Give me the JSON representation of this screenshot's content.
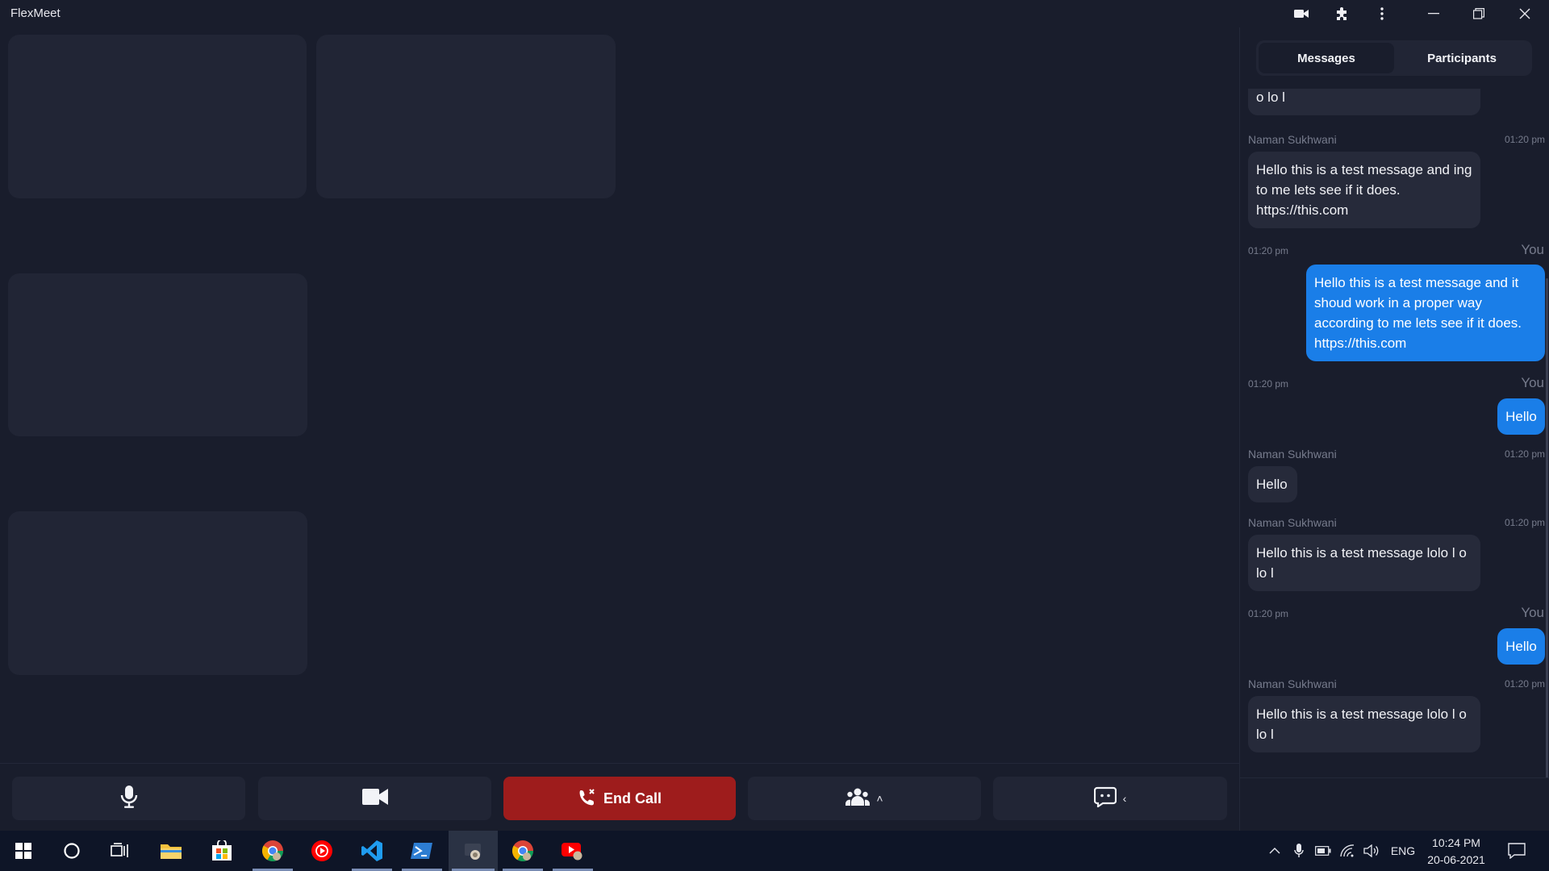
{
  "window": {
    "title": "FlexMeet"
  },
  "titlebar_icons": [
    "video-icon",
    "extension-puzzle-icon",
    "more-vert-icon",
    "minimize-icon",
    "restore-icon",
    "close-icon"
  ],
  "panel": {
    "tabs": [
      {
        "label": "Messages",
        "active": true
      },
      {
        "label": "Participants",
        "active": false
      }
    ]
  },
  "chat": {
    "partial_top": "o lo l",
    "messages": [
      {
        "from": "Naman Sukhwani",
        "time": "01:20 pm",
        "direction": "in",
        "text": "Hello this is a test message and ing to me lets see if it does. https://this.com"
      },
      {
        "from": "You",
        "time": "01:20 pm",
        "direction": "out",
        "text": "Hello this is a test message and it shoud work in a proper way according to me lets see if it does. https://this.com"
      },
      {
        "from": "You",
        "time": "01:20 pm",
        "direction": "out",
        "text": "Hello"
      },
      {
        "from": "Naman Sukhwani",
        "time": "01:20 pm",
        "direction": "in",
        "text": "Hello"
      },
      {
        "from": "Naman Sukhwani",
        "time": "01:20 pm",
        "direction": "in",
        "text": "Hello this is a test message lolo l o lo l"
      },
      {
        "from": "You",
        "time": "01:20 pm",
        "direction": "out",
        "text": "Hello"
      },
      {
        "from": "Naman Sukhwani",
        "time": "01:20 pm",
        "direction": "in",
        "text": "Hello this is a test message lolo l o lo l"
      }
    ]
  },
  "controls": {
    "end_call_label": "End Call",
    "mic": "microphone-icon",
    "camera": "video-camera-icon",
    "participants": "people-icon",
    "chat": "chat-icon",
    "participants_caret": "˄",
    "chat_caret": "‹"
  },
  "colors": {
    "background": "#191d2c",
    "tile": "#212535",
    "end_call": "#9e1c1c",
    "outgoing_bubble": "#1a7ee8",
    "incoming_bubble": "#262a3a"
  },
  "taskbar": {
    "apps": [
      "windows-start-icon",
      "search-circle-icon",
      "task-view-icon",
      "file-explorer-icon",
      "microsoft-store-icon",
      "chrome-icon",
      "youtube-music-icon",
      "vscode-icon",
      "powershell-icon",
      "electron-app-icon",
      "chrome-icon",
      "youtube-app-icon"
    ],
    "language": "ENG",
    "time": "10:24 PM",
    "date": "20-06-2021"
  }
}
